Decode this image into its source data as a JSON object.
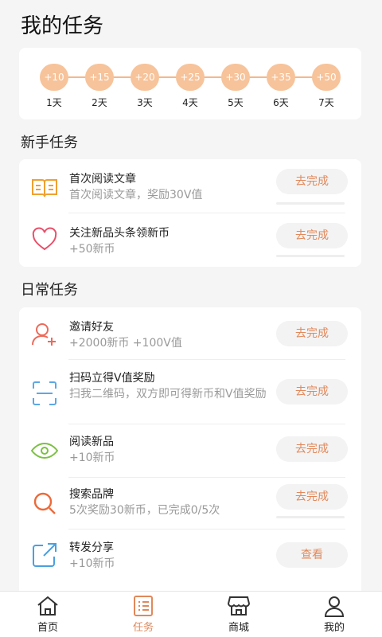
{
  "title": "我的任务",
  "checkin": {
    "days": [
      {
        "reward": "+10",
        "label": "1天"
      },
      {
        "reward": "+15",
        "label": "2天"
      },
      {
        "reward": "+20",
        "label": "3天"
      },
      {
        "reward": "+25",
        "label": "4天"
      },
      {
        "reward": "+30",
        "label": "5天"
      },
      {
        "reward": "+35",
        "label": "6天"
      },
      {
        "reward": "+50",
        "label": "7天"
      }
    ]
  },
  "newbie": {
    "title": "新手任务",
    "tasks": [
      {
        "icon": "book-icon",
        "name": "首次阅读文章",
        "desc": "首次阅读文章，奖励30V值",
        "button": "去完成"
      },
      {
        "icon": "heart-icon",
        "name": "关注新品头条领新币",
        "desc": "+50新币",
        "button": "去完成"
      }
    ]
  },
  "daily": {
    "title": "日常任务",
    "tasks": [
      {
        "icon": "add-user-icon",
        "name": "邀请好友",
        "desc": "+2000新币 +100V值",
        "button": "去完成"
      },
      {
        "icon": "scan-icon",
        "name": "扫码立得V值奖励",
        "desc": "扫我二维码，双方即可得新币和V值奖励",
        "button": "去完成"
      },
      {
        "icon": "eye-icon",
        "name": "阅读新品",
        "desc": "+10新币",
        "button": "去完成"
      },
      {
        "icon": "search-icon",
        "name": "搜索品牌",
        "desc": "5次奖励30新币，已完成0/5次",
        "button": "去完成"
      },
      {
        "icon": "share-icon",
        "name": "转发分享",
        "desc": "+10新币",
        "button": "查看"
      }
    ]
  },
  "tabbar": {
    "items": [
      {
        "icon": "home-icon",
        "label": "首页"
      },
      {
        "icon": "task-list-icon",
        "label": "任务"
      },
      {
        "icon": "store-icon",
        "label": "商城"
      },
      {
        "icon": "profile-icon",
        "label": "我的"
      }
    ],
    "active": "任务"
  },
  "colors": {
    "accent": "#e2885a",
    "reward_circle": "#f7c39a",
    "track": "#f4b98a",
    "book": "#f0a030",
    "heart": "#e8506a",
    "add_user": "#ec6a5a",
    "scan": "#5aa8e6",
    "eye": "#7cc042",
    "search": "#ec6a3a",
    "share": "#4aa0e0"
  }
}
